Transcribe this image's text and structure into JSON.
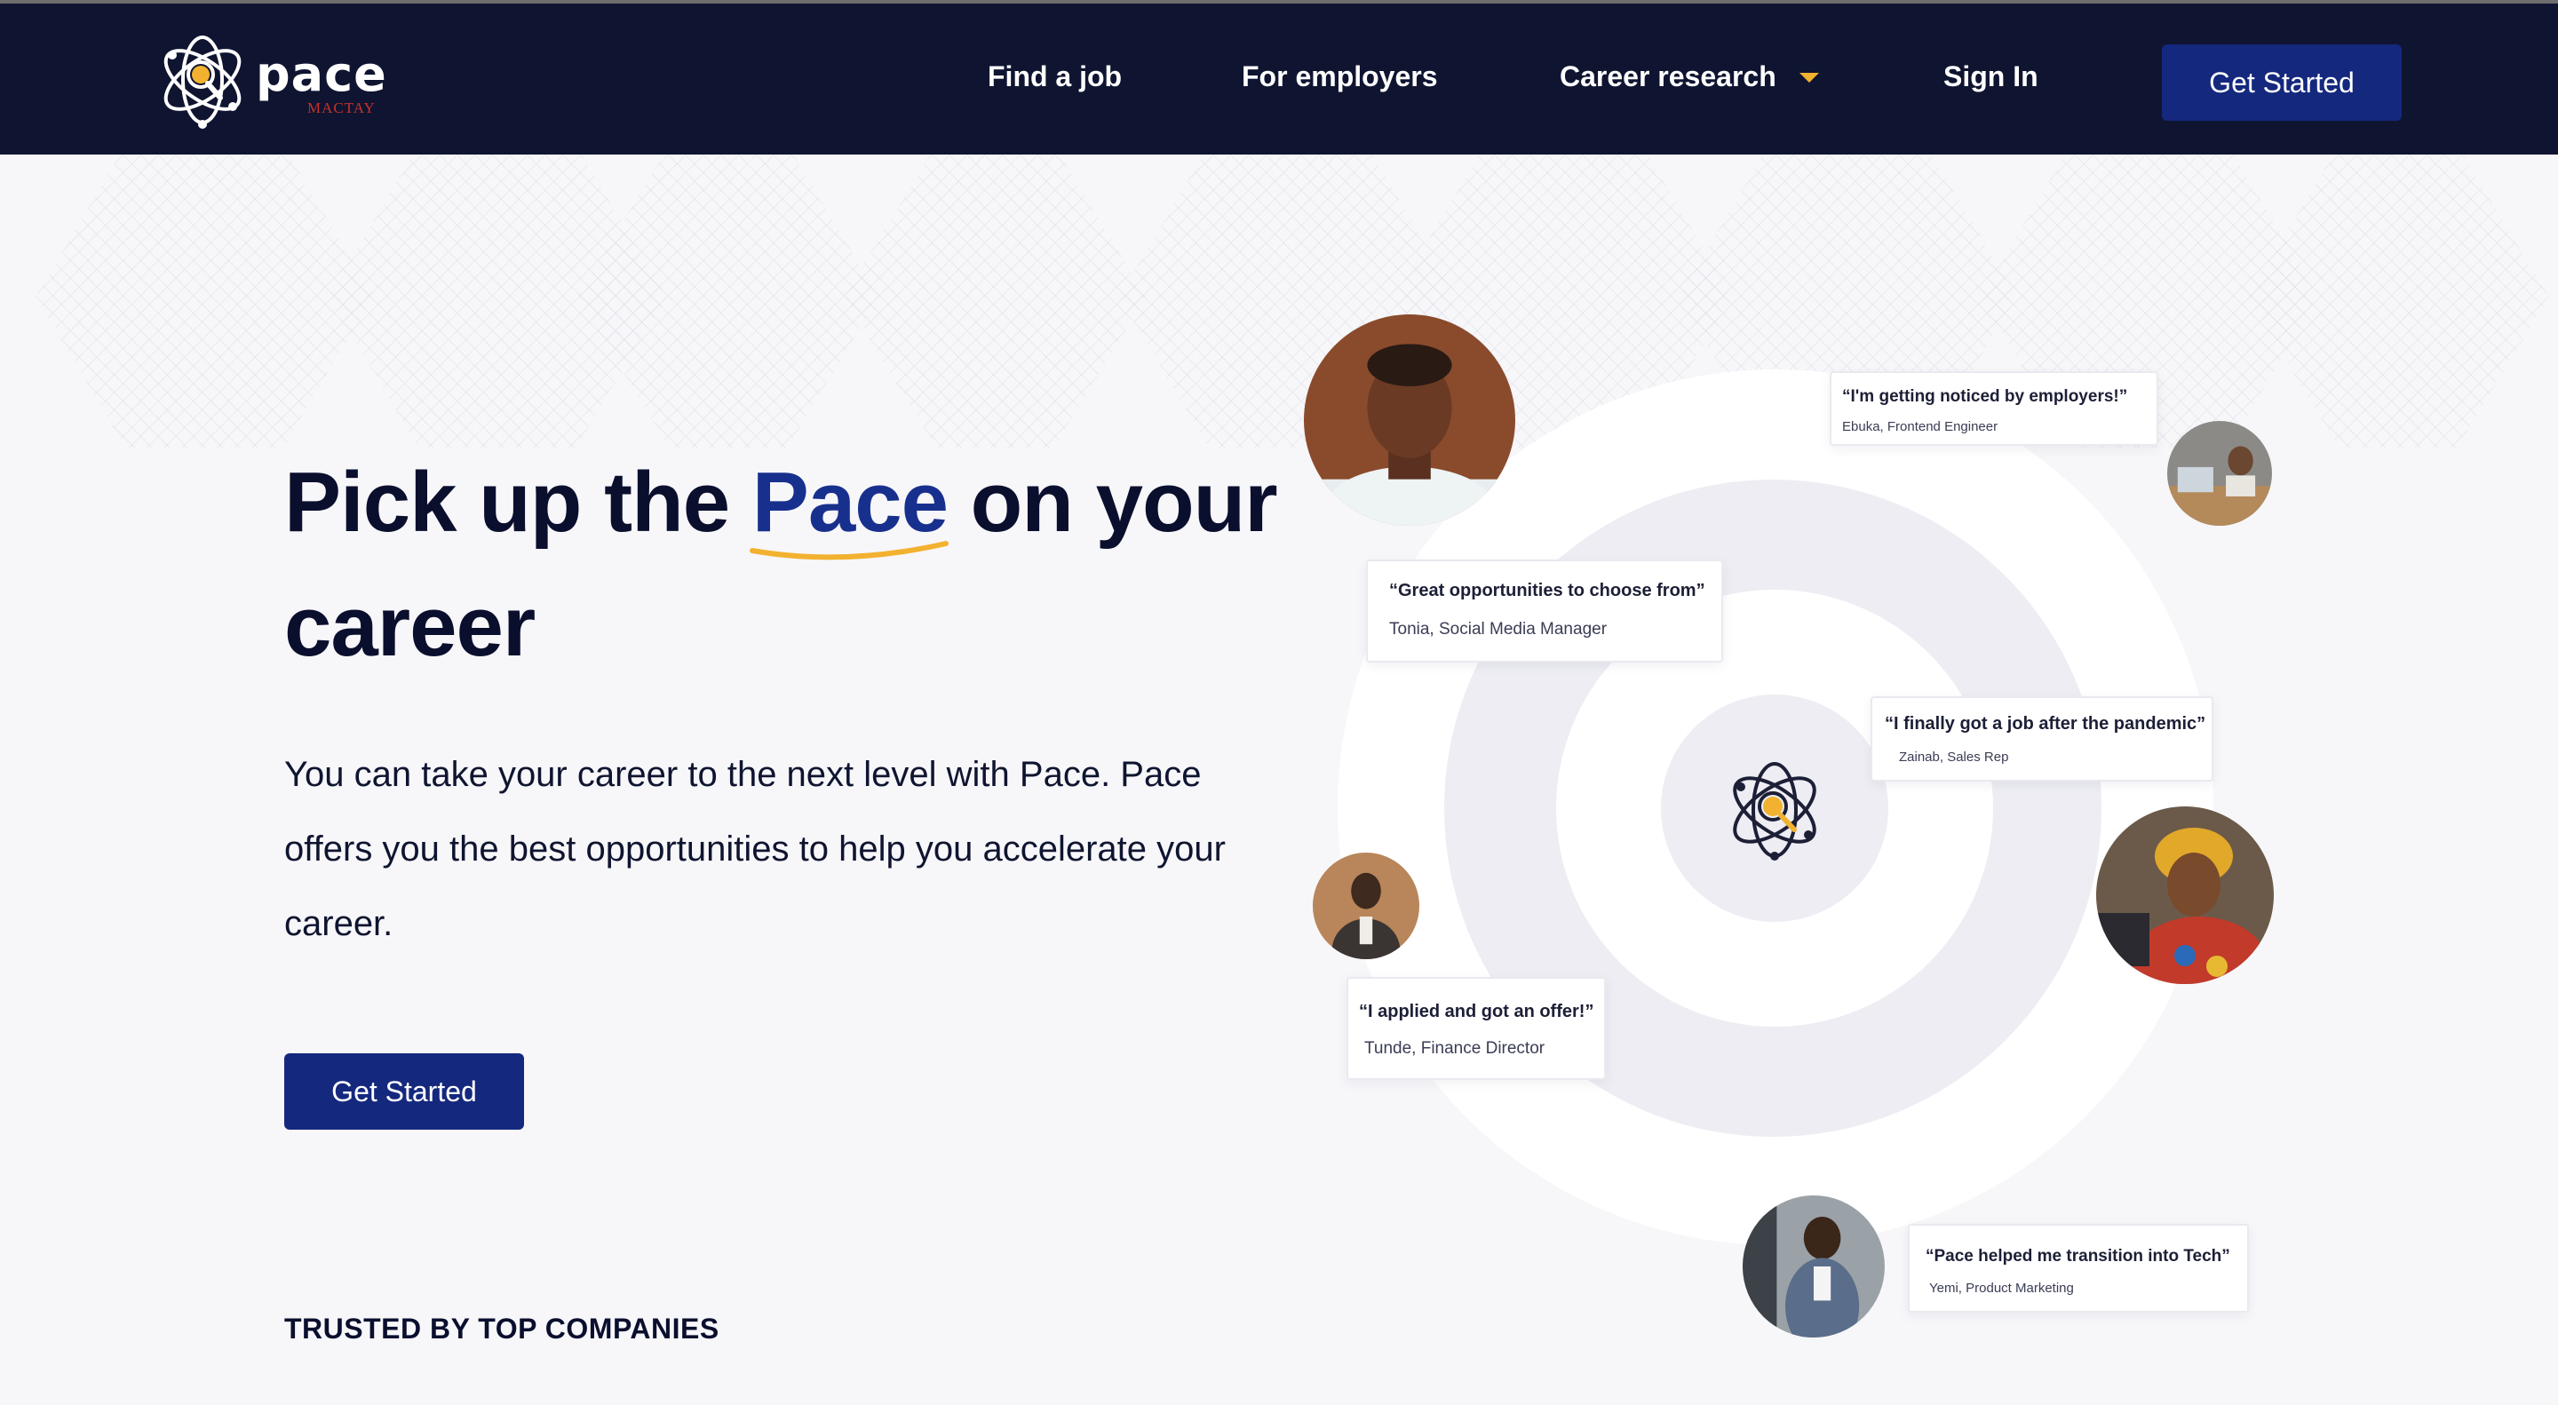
{
  "brand": {
    "name": "pace",
    "sub": "MACTAY",
    "colors": {
      "nav_bg": "#0f1531",
      "primary": "#14287e",
      "accent_text": "#18308d",
      "highlight": "#f2b230",
      "sub_red": "#c9302c"
    }
  },
  "nav": {
    "items": [
      {
        "label": "Find a job"
      },
      {
        "label": "For employers"
      },
      {
        "label": "Career research",
        "icon": "chevron-down-icon"
      },
      {
        "label": "Sign In"
      }
    ],
    "cta": "Get Started"
  },
  "hero": {
    "title_part1": "Pick up the ",
    "title_accent": "Pace",
    "title_part2": " on your career",
    "subtitle": "You can take your career to the next level with Pace. Pace offers you the best opportunities to help you accelerate your career.",
    "cta": "Get Started",
    "trusted": "TRUSTED BY TOP COMPANIES"
  },
  "testimonials": [
    {
      "quote": "“I'm getting noticed by employers!”",
      "author": "Ebuka, Frontend Engineer"
    },
    {
      "quote": "“Great opportunities to choose from”",
      "author": "Tonia, Social Media Manager"
    },
    {
      "quote": "“I finally got a job after the pandemic”",
      "author": "Zainab, Sales Rep"
    },
    {
      "quote": "“I applied and got an offer!”",
      "author": "Tunde, Finance Director"
    },
    {
      "quote": "“Pace helped me transition into Tech”",
      "author": "Yemi, Product Marketing"
    }
  ]
}
